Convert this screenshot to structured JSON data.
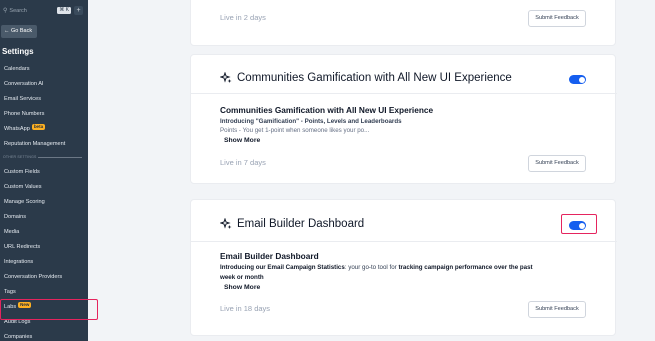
{
  "sidebar": {
    "search_placeholder": "Search",
    "search_shortcut": "⌘ K",
    "add_label": "+",
    "go_back": "← Go Back",
    "title": "Settings",
    "items": [
      {
        "label": "Calendars"
      },
      {
        "label": "Conversation AI"
      },
      {
        "label": "Email Services"
      },
      {
        "label": "Phone Numbers"
      },
      {
        "label": "WhatsApp",
        "badge": "beta"
      },
      {
        "label": "Reputation Management"
      },
      {
        "label": "Custom Fields"
      },
      {
        "label": "Custom Values"
      },
      {
        "label": "Manage Scoring"
      },
      {
        "label": "Domains"
      },
      {
        "label": "Media"
      },
      {
        "label": "URL Redirects"
      },
      {
        "label": "Integrations"
      },
      {
        "label": "Conversation Providers"
      },
      {
        "label": "Tags"
      },
      {
        "label": "Labs",
        "badge": "New"
      },
      {
        "label": "Audit Logs"
      },
      {
        "label": "Companies"
      }
    ],
    "section_label": "OTHER SETTINGS"
  },
  "cards": {
    "top": {
      "live": "Live in 2 days",
      "feedback": "Submit Feedback"
    },
    "gamification": {
      "title": "Communities Gamification with All New UI Experience",
      "toggle_on": true,
      "sub_title": "Communities Gamification with All New UI Experience",
      "intro": "Introducing \"Gamification\" - Points, Levels and Leaderboards",
      "snippet": "Points - You get 1-point when someone likes your po...",
      "show_more": "Show More",
      "live": "Live in 7 days",
      "feedback": "Submit Feedback"
    },
    "email_builder": {
      "title": "Email Builder Dashboard",
      "toggle_on": true,
      "sub_title": "Email Builder Dashboard",
      "intro_prefix": "Introducing our Email Campaign Statistics",
      "intro_mid": ": your go-to tool for ",
      "intro_bold": "tracking campaign performance over the past",
      "intro_line2": "week or month",
      "show_more": "Show More",
      "live": "Live in 18 days",
      "feedback": "Submit Feedback"
    }
  },
  "colors": {
    "sidebar_bg": "#2b3a4a",
    "toggle_on": "#155eef",
    "highlight": "#e5245e",
    "badge": "#fdb022"
  }
}
